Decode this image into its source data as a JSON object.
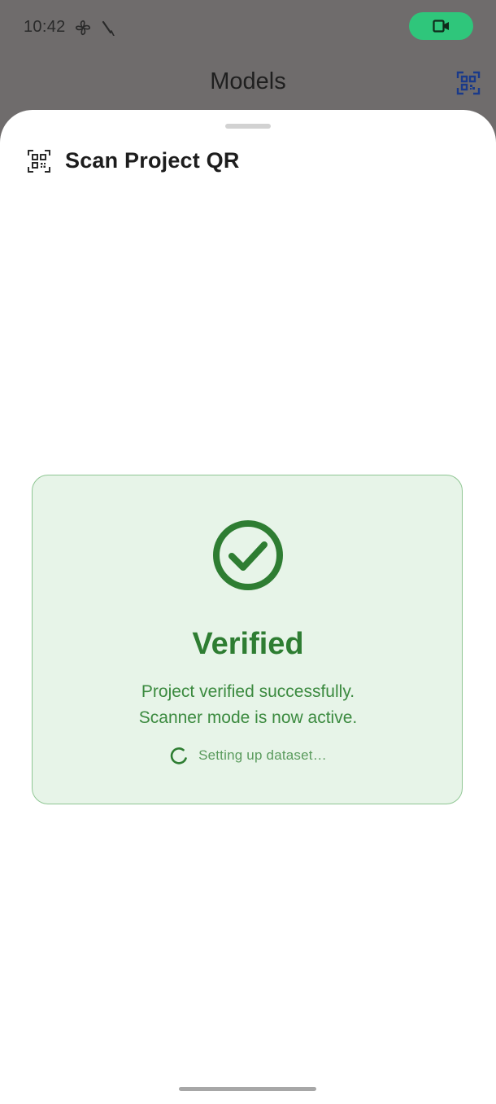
{
  "status_bar": {
    "time": "10:42",
    "fan_icon": "fan-icon",
    "signal_icon": "signal-icon",
    "record_icon": "video-camera-icon",
    "record_color": "#2fc67b"
  },
  "app_bar": {
    "title": "Models",
    "action_icon": "qr-code-icon"
  },
  "sheet": {
    "header_icon": "qr-scan-icon",
    "title": "Scan Project QR"
  },
  "verified_card": {
    "icon": "check-circle-icon",
    "title": "Verified",
    "message_line1": "Project verified successfully.",
    "message_line2": "Scanner mode is now active.",
    "progress_text": "Setting up dataset…",
    "accent_color": "#2e7d32",
    "background_color": "#e7f4e8"
  }
}
